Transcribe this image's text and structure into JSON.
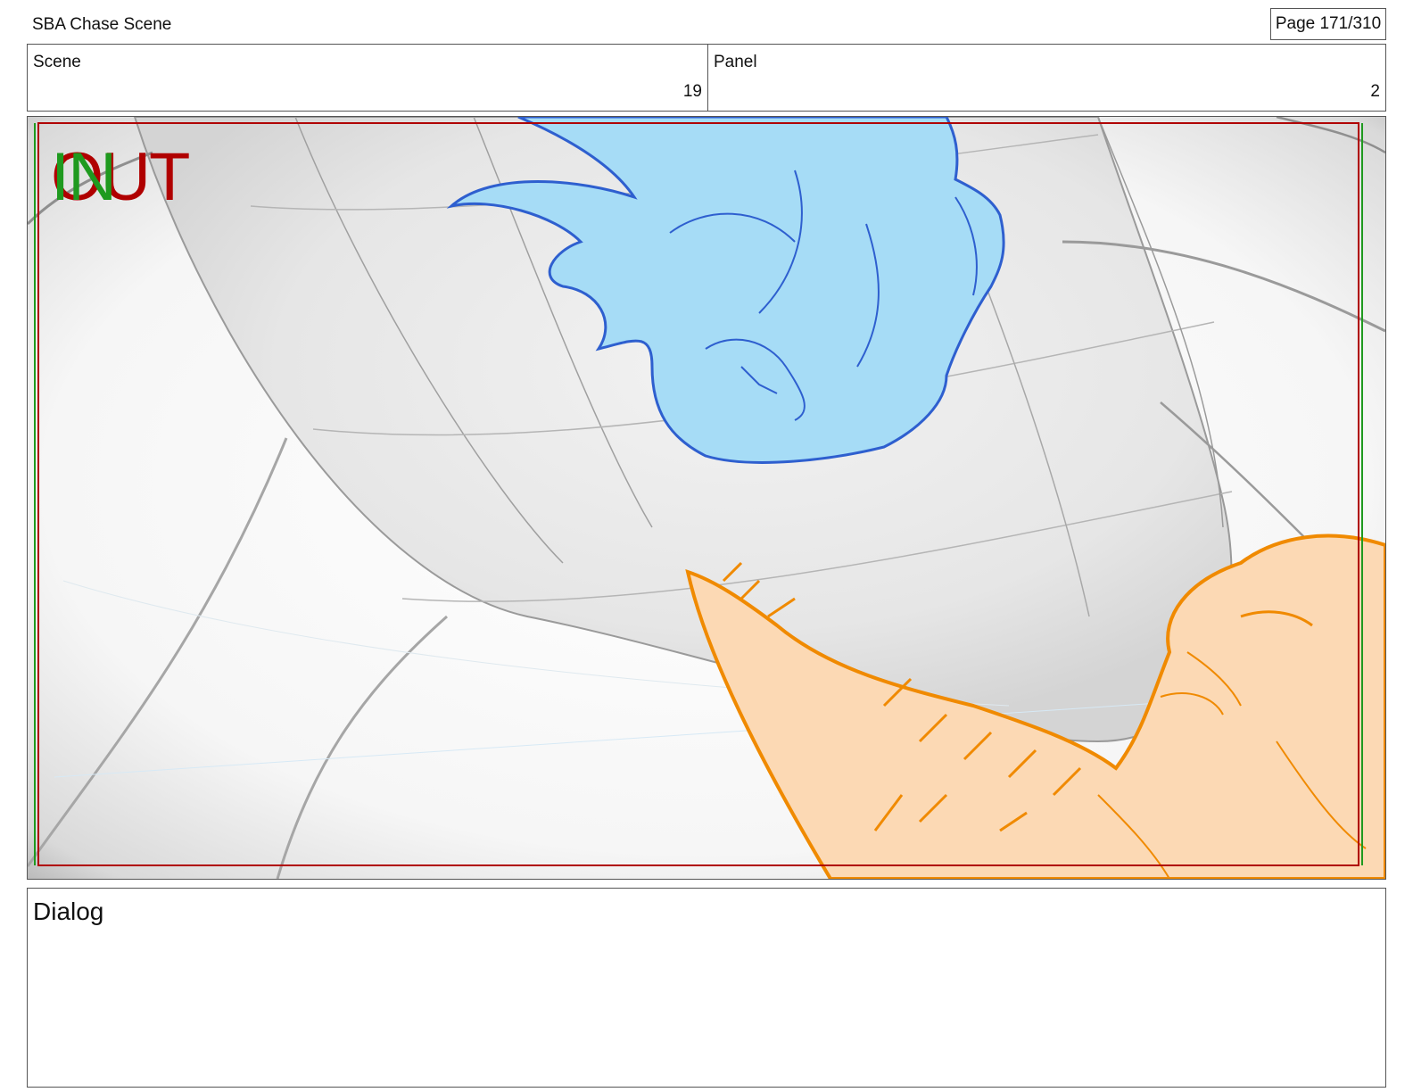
{
  "header": {
    "project_title": "SBA Chase Scene",
    "page_label": "Page 171/310"
  },
  "info": {
    "scene_label": "Scene",
    "scene_value": "19",
    "panel_label": "Panel",
    "panel_value": "2"
  },
  "frame": {
    "in_marker": "IN",
    "out_marker": "OUT",
    "colors": {
      "figure_blue_fill": "#a6dcf6",
      "figure_blue_line": "#2e5fcf",
      "figure_orange_fill": "#fcd9b4",
      "figure_orange_line": "#f08a00",
      "safe_area_red": "#b00000",
      "safe_area_green": "#1f9a1f"
    }
  },
  "dialog": {
    "label": "Dialog"
  }
}
